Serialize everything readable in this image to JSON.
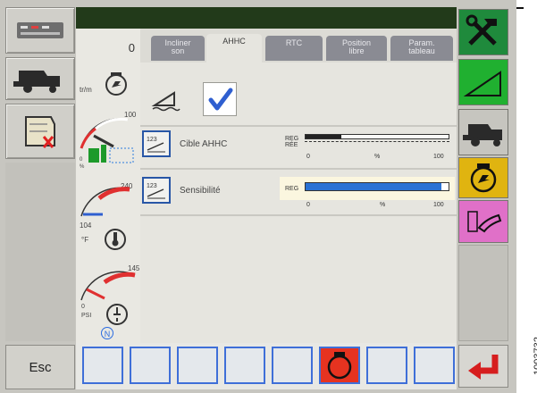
{
  "counter": "0",
  "engine": {
    "rpm_unit": "tr/m"
  },
  "fuel_gauge": {
    "max": "100",
    "min": "0",
    "unit": "%"
  },
  "temp_gauge": {
    "max": "240",
    "value": "104",
    "unit": "°F"
  },
  "pressure_gauge": {
    "max": "145",
    "min": "0",
    "unit": "PSI"
  },
  "gear_indicator": "N",
  "tabs": [
    {
      "label": "Incliner\nson",
      "active": false
    },
    {
      "label": "AHHC",
      "active": true
    },
    {
      "label": "RTC",
      "active": false
    },
    {
      "label": "Position\nlibre",
      "active": false
    },
    {
      "label": "Param.\ntableau",
      "active": false
    }
  ],
  "settings": [
    {
      "label": "Cible AHHC",
      "reg_label": "REG\nRÉE",
      "scale_min": "0",
      "scale_unit": "%",
      "scale_max": "100",
      "value": 0.25
    },
    {
      "label": "Sensibilité",
      "reg_label": "REG",
      "scale_min": "0",
      "scale_unit": "%",
      "scale_max": "100",
      "value": 0.95
    }
  ],
  "esc_label": "Esc",
  "figure_code": "1003732",
  "colors": {
    "top_bar": "#223a1a",
    "tab_inactive": "#8a8b93",
    "accent_blue": "#2f5fd0",
    "engine_red": "#e63320",
    "enter_red": "#d61e1e"
  }
}
